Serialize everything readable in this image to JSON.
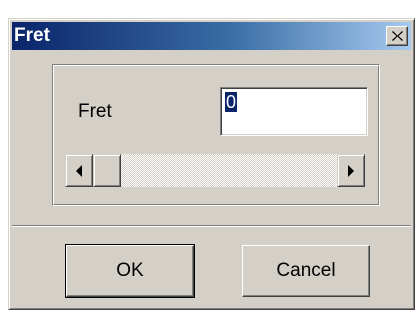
{
  "window": {
    "title": "Fret"
  },
  "titlebar": {
    "close_icon": "close-icon"
  },
  "form": {
    "fret_label": "Fret",
    "fret_value": "0"
  },
  "scrollbar": {
    "left_icon": "arrow-left-icon",
    "right_icon": "arrow-right-icon",
    "position": 0
  },
  "buttons": {
    "ok_label": "OK",
    "cancel_label": "Cancel"
  },
  "colors": {
    "titlebar_start": "#0a246a",
    "titlebar_end": "#a6caf0",
    "dialog_face": "#d4d0c8"
  }
}
